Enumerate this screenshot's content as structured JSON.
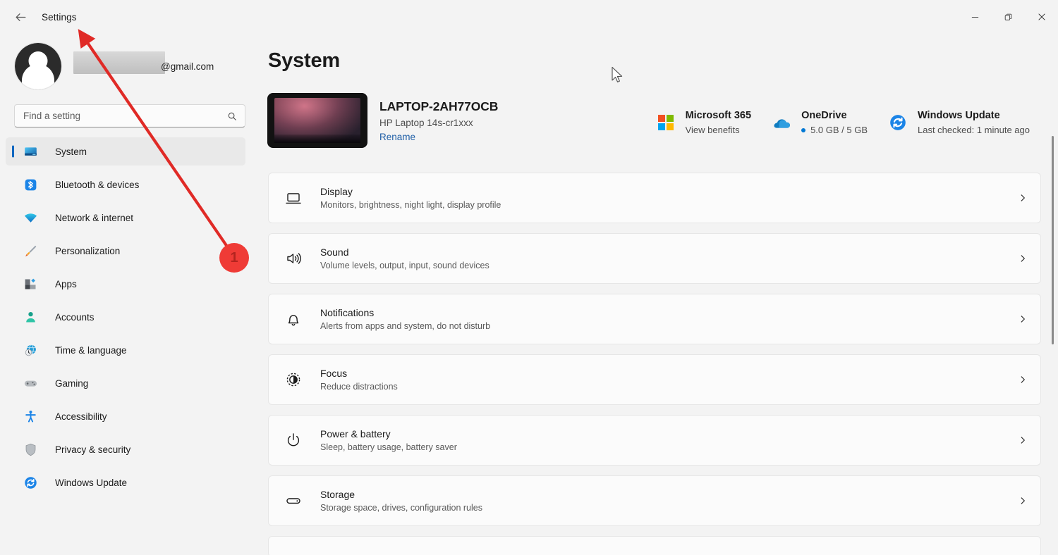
{
  "titlebar": {
    "back_icon": "back-arrow-icon",
    "title": "Settings",
    "minimize": "minimize-icon",
    "restore": "restore-icon",
    "close": "close-icon"
  },
  "account": {
    "name_redacted": "",
    "email_suffix": "@gmail.com"
  },
  "search": {
    "placeholder": "Find a setting",
    "value": "",
    "icon": "search-icon"
  },
  "sidebar": {
    "items": [
      {
        "label": "System",
        "icon": "monitor-icon",
        "selected": true
      },
      {
        "label": "Bluetooth & devices",
        "icon": "bluetooth-icon",
        "selected": false
      },
      {
        "label": "Network & internet",
        "icon": "wifi-icon",
        "selected": false
      },
      {
        "label": "Personalization",
        "icon": "paintbrush-icon",
        "selected": false
      },
      {
        "label": "Apps",
        "icon": "apps-icon",
        "selected": false
      },
      {
        "label": "Accounts",
        "icon": "person-icon",
        "selected": false
      },
      {
        "label": "Time & language",
        "icon": "clock-globe-icon",
        "selected": false
      },
      {
        "label": "Gaming",
        "icon": "gamepad-icon",
        "selected": false
      },
      {
        "label": "Accessibility",
        "icon": "accessibility-icon",
        "selected": false
      },
      {
        "label": "Privacy & security",
        "icon": "shield-icon",
        "selected": false
      },
      {
        "label": "Windows Update",
        "icon": "update-icon",
        "selected": false
      }
    ]
  },
  "main": {
    "page_title": "System",
    "device": {
      "name": "LAPTOP-2AH77OCB",
      "model": "HP Laptop 14s-cr1xxx",
      "rename_label": "Rename"
    },
    "status_cards": [
      {
        "title": "Microsoft 365",
        "subtitle": "View benefits",
        "icon": "microsoft-logo-icon",
        "has_dot": false
      },
      {
        "title": "OneDrive",
        "subtitle": "5.0 GB / 5 GB",
        "icon": "onedrive-cloud-icon",
        "has_dot": true
      },
      {
        "title": "Windows Update",
        "subtitle": "Last checked: 1 minute ago",
        "icon": "update-icon",
        "has_dot": false
      }
    ],
    "settings_list": [
      {
        "title": "Display",
        "subtitle": "Monitors, brightness, night light, display profile",
        "icon": "display-icon"
      },
      {
        "title": "Sound",
        "subtitle": "Volume levels, output, input, sound devices",
        "icon": "speaker-icon"
      },
      {
        "title": "Notifications",
        "subtitle": "Alerts from apps and system, do not disturb",
        "icon": "bell-icon"
      },
      {
        "title": "Focus",
        "subtitle": "Reduce distractions",
        "icon": "focus-icon"
      },
      {
        "title": "Power & battery",
        "subtitle": "Sleep, battery usage, battery saver",
        "icon": "power-icon"
      },
      {
        "title": "Storage",
        "subtitle": "Storage space, drives, configuration rules",
        "icon": "storage-icon"
      }
    ]
  },
  "annotation": {
    "badge_number": "1",
    "arrow_color": "#e02a26",
    "points_to": "Settings"
  },
  "colors": {
    "accent": "#0067c0",
    "window_bg": "#f3f3f3",
    "card_bg": "#fbfbfb",
    "link": "#1d5da6",
    "annotation_red": "#ef3b36"
  }
}
